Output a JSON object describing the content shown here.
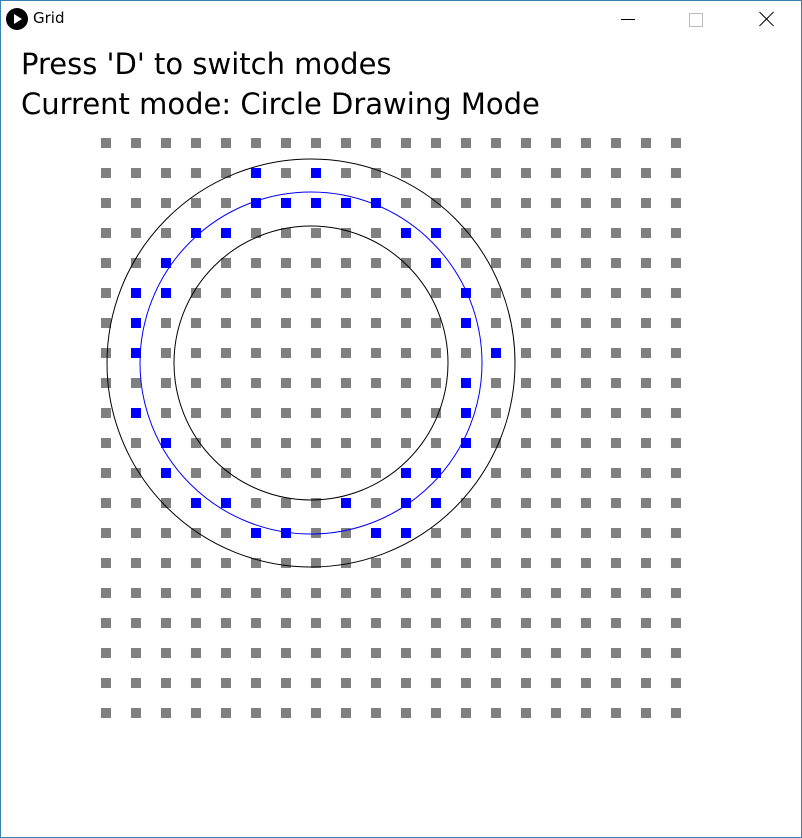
{
  "window": {
    "title": "Grid",
    "app_icon": "processing-play-icon",
    "controls": [
      "minimize",
      "maximize",
      "close"
    ]
  },
  "instructions": {
    "line1": "Press 'D' to switch modes",
    "line2": "Current mode: Circle Drawing Mode"
  },
  "grid": {
    "columns": 20,
    "rows": 20,
    "inactive_color": "#808080",
    "active_color": "#0000ff",
    "active_cells": [
      [
        5,
        1
      ],
      [
        7,
        1
      ],
      [
        5,
        2
      ],
      [
        6,
        2
      ],
      [
        7,
        2
      ],
      [
        8,
        2
      ],
      [
        9,
        2
      ],
      [
        3,
        3
      ],
      [
        4,
        3
      ],
      [
        10,
        3
      ],
      [
        11,
        3
      ],
      [
        2,
        4
      ],
      [
        11,
        4
      ],
      [
        1,
        5
      ],
      [
        2,
        5
      ],
      [
        12,
        5
      ],
      [
        1,
        6
      ],
      [
        12,
        6
      ],
      [
        1,
        7
      ],
      [
        13,
        7
      ],
      [
        12,
        8
      ],
      [
        1,
        9
      ],
      [
        12,
        9
      ],
      [
        2,
        10
      ],
      [
        12,
        10
      ],
      [
        2,
        11
      ],
      [
        10,
        11
      ],
      [
        11,
        11
      ],
      [
        12,
        11
      ],
      [
        3,
        12
      ],
      [
        4,
        12
      ],
      [
        8,
        12
      ],
      [
        10,
        12
      ],
      [
        11,
        12
      ],
      [
        5,
        13
      ],
      [
        6,
        13
      ],
      [
        9,
        13
      ],
      [
        10,
        13
      ]
    ]
  },
  "circles": {
    "outer_color": "#000000",
    "inner_color": "#000000",
    "middle_color": "#0000ff"
  }
}
